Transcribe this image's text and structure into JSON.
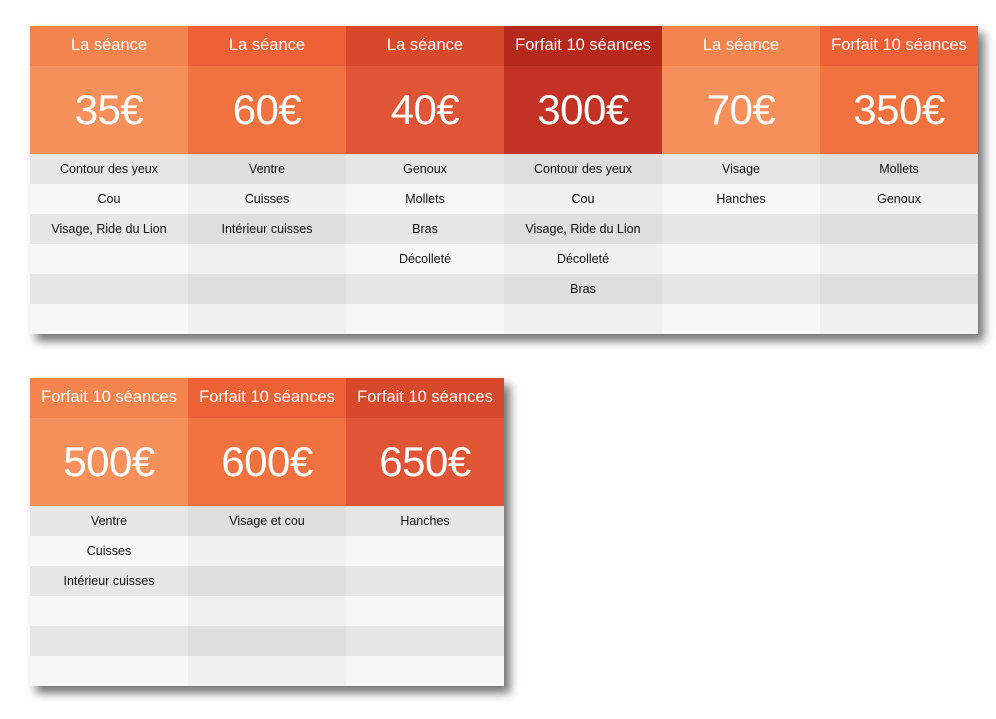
{
  "colors": {
    "orange_light_head": "#f4844d",
    "orange_light_price": "#f7905a",
    "orange_mid_head": "#ec6236",
    "orange_mid_price": "#f0733f",
    "red_orange_head": "#d64a2b",
    "red_orange_price": "#df5536",
    "dark_red_head": "#b5291c",
    "dark_red_price": "#c23325"
  },
  "table_1": {
    "columns": [
      {
        "header": "La séance",
        "price": "35€",
        "rows": [
          "Contour des yeux",
          "Cou",
          "Visage, Ride du Lion",
          "",
          "",
          ""
        ]
      },
      {
        "header": "La séance",
        "price": "60€",
        "rows": [
          "Ventre",
          "Cuisses",
          "Intérieur cuisses",
          "",
          "",
          ""
        ]
      },
      {
        "header": "La séance",
        "price": "40€",
        "rows": [
          "Genoux",
          "Mollets",
          "Bras",
          "Décolleté",
          "",
          ""
        ]
      },
      {
        "header": "Forfait 10 séances",
        "price": "300€",
        "rows": [
          "Contour des yeux",
          "Cou",
          "Visage, Ride du Lion",
          "Décolleté",
          "Bras",
          ""
        ]
      },
      {
        "header": "La séance",
        "price": "70€",
        "rows": [
          "Visage",
          "Hanches",
          "",
          "",
          "",
          ""
        ]
      },
      {
        "header": "Forfait 10 séances",
        "price": "350€",
        "rows": [
          "Mollets",
          "Genoux",
          "",
          "",
          "",
          ""
        ]
      }
    ]
  },
  "table_2": {
    "columns": [
      {
        "header": "Forfait 10 séances",
        "price": "500€",
        "rows": [
          "Ventre",
          "Cuisses",
          "Intérieur cuisses",
          "",
          "",
          ""
        ]
      },
      {
        "header": "Forfait 10 séances",
        "price": "600€",
        "rows": [
          "Visage et cou",
          "",
          "",
          "",
          "",
          ""
        ]
      },
      {
        "header": "Forfait 10 séances",
        "price": "650€",
        "rows": [
          "Hanches",
          "",
          "",
          "",
          "",
          ""
        ]
      }
    ]
  }
}
